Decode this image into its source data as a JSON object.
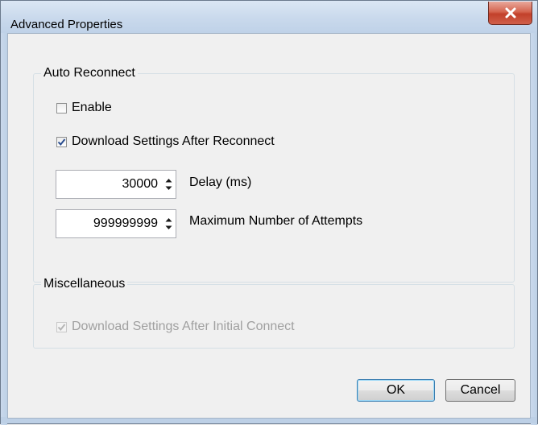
{
  "window": {
    "title": "Advanced Properties"
  },
  "auto_reconnect": {
    "legend": "Auto Reconnect",
    "enable": {
      "label": "Enable",
      "checked": false
    },
    "download_after_reconnect": {
      "label": "Download Settings After Reconnect",
      "checked": true
    },
    "delay": {
      "value": "30000",
      "label": "Delay (ms)"
    },
    "max_attempts": {
      "value": "999999999",
      "label": "Maximum Number of Attempts"
    }
  },
  "miscellaneous": {
    "legend": "Miscellaneous",
    "download_after_initial": {
      "label": "Download Settings After Initial Connect",
      "checked": true,
      "disabled": true
    }
  },
  "buttons": {
    "ok": "OK",
    "cancel": "Cancel"
  },
  "icons": {
    "close": "close-icon",
    "spin_up": "chevron-up-icon",
    "spin_down": "chevron-down-icon",
    "check": "checkmark-icon"
  },
  "colors": {
    "close_button": "#c2402a",
    "title_bar": "#c9d9ec",
    "check_mark": "#2a4d8f",
    "default_button_border": "#3c7fb1"
  }
}
